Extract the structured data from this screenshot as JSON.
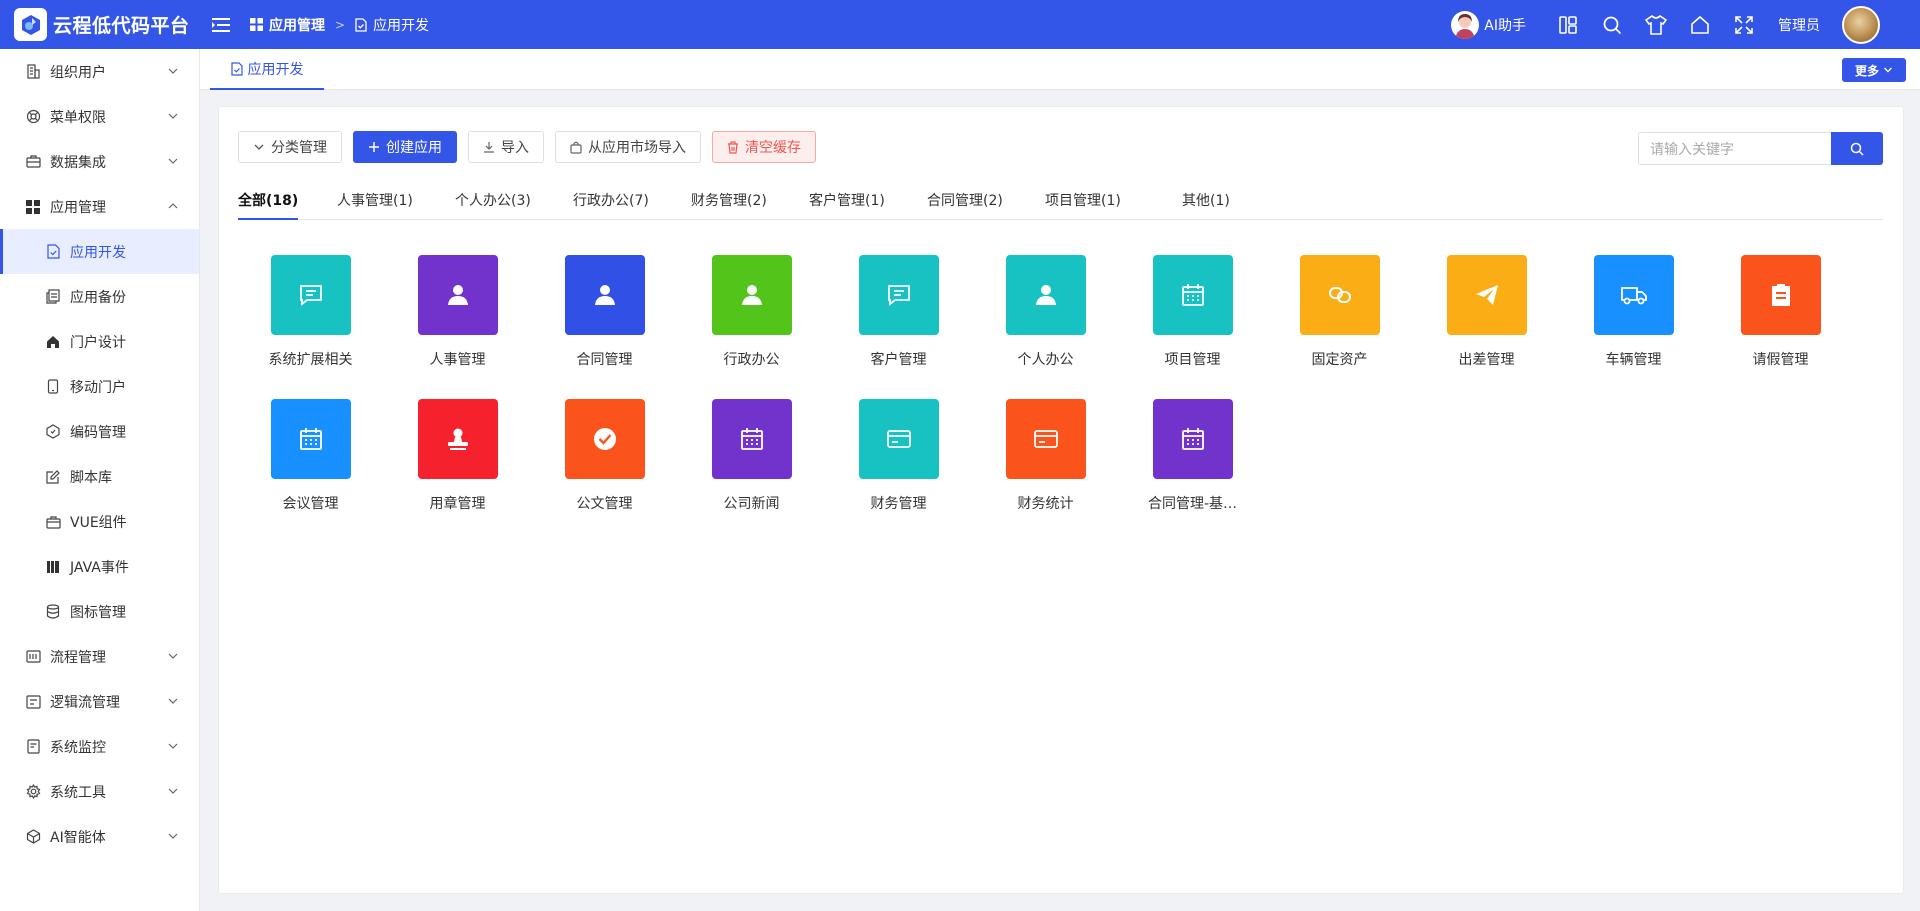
{
  "header": {
    "app_name": "云程低代码平台",
    "breadcrumb": [
      "应用管理",
      "应用开发"
    ],
    "ai_helper_label": "AI助手",
    "user_name": "管理员",
    "colors": {
      "primary": "#3456e8"
    }
  },
  "sidebar": {
    "items": [
      {
        "label": "组织用户",
        "icon": "building-icon",
        "expanded": false
      },
      {
        "label": "菜单权限",
        "icon": "lifebuoy-icon",
        "expanded": false
      },
      {
        "label": "数据集成",
        "icon": "briefcase-icon",
        "expanded": false
      },
      {
        "label": "应用管理",
        "icon": "grid-icon",
        "expanded": true
      },
      {
        "label": "流程管理",
        "icon": "flow-icon",
        "expanded": false
      },
      {
        "label": "逻辑流管理",
        "icon": "logic-icon",
        "expanded": false
      },
      {
        "label": "系统监控",
        "icon": "monitor-icon",
        "expanded": false
      },
      {
        "label": "系统工具",
        "icon": "gear-icon",
        "expanded": false
      },
      {
        "label": "AI智能体",
        "icon": "cube-icon",
        "expanded": false
      }
    ],
    "subitems": [
      {
        "label": "应用开发",
        "icon": "file-check-icon",
        "active": true
      },
      {
        "label": "应用备份",
        "icon": "copy-icon",
        "active": false
      },
      {
        "label": "门户设计",
        "icon": "home-icon",
        "active": false
      },
      {
        "label": "移动门户",
        "icon": "mobile-icon",
        "active": false
      },
      {
        "label": "编码管理",
        "icon": "hexagon-icon",
        "active": false
      },
      {
        "label": "脚本库",
        "icon": "edit-icon",
        "active": false
      },
      {
        "label": "VUE组件",
        "icon": "briefcase-icon",
        "active": false
      },
      {
        "label": "JAVA事件",
        "icon": "book-icon",
        "active": false
      },
      {
        "label": "图标管理",
        "icon": "database-icon",
        "active": false
      }
    ]
  },
  "tabs": {
    "current": "应用开发",
    "more_label": "更多"
  },
  "toolbar": {
    "category_manage": "分类管理",
    "create_app": "创建应用",
    "import": "导入",
    "market_import": "从应用市场导入",
    "clear_cache": "清空缓存"
  },
  "search": {
    "placeholder": "请输入关键字"
  },
  "categories": [
    "全部(18)",
    "人事管理(1)",
    "个人办公(3)",
    "行政办公(7)",
    "财务管理(2)",
    "客户管理(1)",
    "合同管理(2)",
    "项目管理(1)",
    "其他(1)"
  ],
  "apps": [
    {
      "label": "系统扩展相关",
      "color": "#18c2c2",
      "icon": "chat-icon"
    },
    {
      "label": "人事管理",
      "color": "#7232cc",
      "icon": "user-icon"
    },
    {
      "label": "合同管理",
      "color": "#3050e6",
      "icon": "user-icon"
    },
    {
      "label": "行政办公",
      "color": "#52c41a",
      "icon": "user-icon"
    },
    {
      "label": "客户管理",
      "color": "#18c2c2",
      "icon": "chat-icon"
    },
    {
      "label": "个人办公",
      "color": "#18c2c2",
      "icon": "user-icon"
    },
    {
      "label": "项目管理",
      "color": "#18c2c2",
      "icon": "calendar-icon"
    },
    {
      "label": "固定资产",
      "color": "#faad14",
      "icon": "link-icon"
    },
    {
      "label": "出差管理",
      "color": "#faad14",
      "icon": "plane-icon"
    },
    {
      "label": "车辆管理",
      "color": "#1890ff",
      "icon": "truck-icon"
    },
    {
      "label": "请假管理",
      "color": "#fa541c",
      "icon": "clipboard-icon"
    },
    {
      "label": "会议管理",
      "color": "#1890ff",
      "icon": "calendar-icon"
    },
    {
      "label": "用章管理",
      "color": "#f5222d",
      "icon": "stamp-icon"
    },
    {
      "label": "公文管理",
      "color": "#fa541c",
      "icon": "check-circle-icon"
    },
    {
      "label": "公司新闻",
      "color": "#7232cc",
      "icon": "calendar-icon"
    },
    {
      "label": "财务管理",
      "color": "#18c2c2",
      "icon": "card-icon"
    },
    {
      "label": "财务统计",
      "color": "#fa541c",
      "icon": "card-icon"
    },
    {
      "label": "合同管理-基…",
      "color": "#7232cc",
      "icon": "calendar-icon"
    }
  ]
}
